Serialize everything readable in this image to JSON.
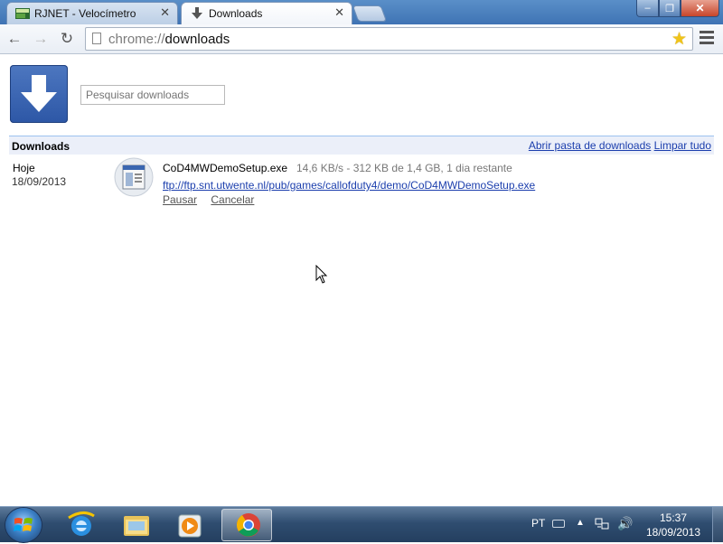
{
  "window": {
    "tabs": [
      {
        "label": "RJNET - Velocímetro",
        "close": "✕"
      },
      {
        "label": "Downloads",
        "close": "✕"
      }
    ],
    "controls": {
      "minimize": "–",
      "maximize": "❐",
      "close": "✕"
    }
  },
  "toolbar": {
    "url_scheme": "chrome://",
    "url_path": "downloads",
    "back": "←",
    "forward": "→",
    "reload": "↻",
    "star": "★"
  },
  "search": {
    "placeholder": "Pesquisar downloads"
  },
  "header": {
    "title": "Downloads",
    "open_folder": "Abrir pasta de downloads",
    "clear_all": "Limpar tudo"
  },
  "downloads": [
    {
      "day": "Hoje",
      "date": "18/09/2013",
      "file_name": "CoD4MWDemoSetup.exe",
      "status": "14,6 KB/s - 312 KB de 1,4 GB, 1 dia restante",
      "url": "ftp://ftp.snt.utwente.nl/pub/games/callofduty4/demo/CoD4MWDemoSetup.exe",
      "actions": [
        "Pausar",
        "Cancelar"
      ]
    }
  ],
  "taskbar": {
    "language": "PT",
    "time": "15:37",
    "date": "18/09/2013",
    "pinned": [
      "start-orb",
      "internet-explorer",
      "windows-explorer",
      "media-player",
      "chrome"
    ]
  },
  "colors": {
    "accent": "#2d57a6",
    "link": "#1b3ead",
    "header_bg": "#ebeff9",
    "header_border": "#9cc2ef",
    "taskbar": "#2f4d70"
  }
}
